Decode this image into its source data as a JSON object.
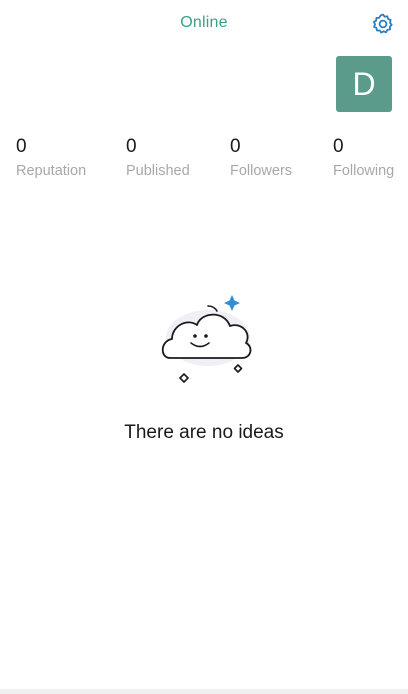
{
  "header": {
    "status": "Online",
    "settings_icon": "gear-icon",
    "accent_color": "#3aa08a"
  },
  "profile": {
    "avatar_letter": "D",
    "avatar_color": "#5b9b8c"
  },
  "stats": [
    {
      "value": "0",
      "label": "Reputation"
    },
    {
      "value": "0",
      "label": "Published"
    },
    {
      "value": "0",
      "label": "Followers"
    },
    {
      "value": "0",
      "label": "Following"
    }
  ],
  "empty_state": {
    "illustration": "smiling-cloud-icon",
    "message": "There are no ideas"
  }
}
